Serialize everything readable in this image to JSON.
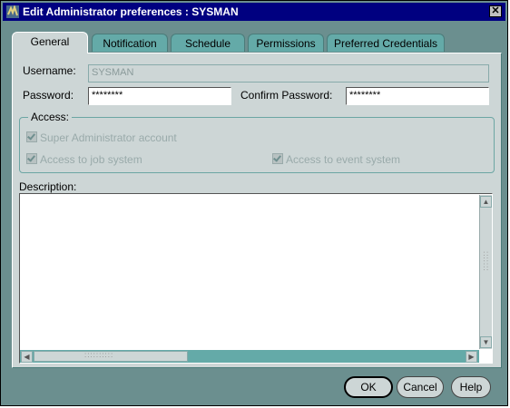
{
  "window": {
    "title": "Edit Administrator preferences : SYSMAN",
    "close_symbol": "✕"
  },
  "tabs": [
    {
      "label": "General",
      "active": true
    },
    {
      "label": "Notification",
      "active": false
    },
    {
      "label": "Schedule",
      "active": false
    },
    {
      "label": "Permissions",
      "active": false
    },
    {
      "label": "Preferred Credentials",
      "active": false
    }
  ],
  "form": {
    "username_label": "Username:",
    "username_value": "SYSMAN",
    "password_label": "Password:",
    "password_value": "********",
    "confirm_label": "Confirm Password:",
    "confirm_value": "********"
  },
  "access": {
    "label": "Access:",
    "super_admin": "Super Administrator account",
    "job_system": "Access to job system",
    "event_system": "Access to event system"
  },
  "description": {
    "label": "Description:",
    "value": ""
  },
  "buttons": {
    "ok": "OK",
    "cancel": "Cancel",
    "help": "Help"
  },
  "colors": {
    "titlebar": "#000080",
    "frame": "#6b8f8f",
    "panel": "#cdd6d6",
    "tab": "#64aaa8"
  },
  "icons": {
    "app": "app-icon",
    "close": "close-icon",
    "scroll_up": "scroll-up-icon",
    "scroll_down": "scroll-down-icon",
    "scroll_left": "scroll-left-icon",
    "scroll_right": "scroll-right-icon"
  }
}
